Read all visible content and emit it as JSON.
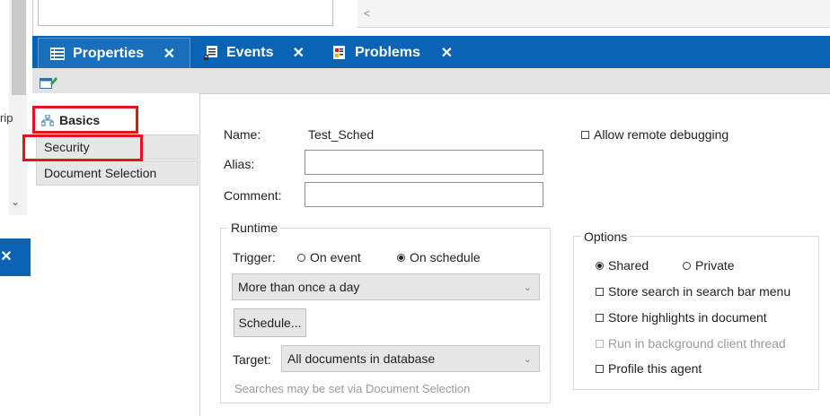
{
  "left_panel": {
    "clipped_text": "rip",
    "close_glyph": "✕"
  },
  "tabs": [
    {
      "label": "Properties",
      "icon": "properties-icon",
      "close": "✕",
      "active": true
    },
    {
      "label": "Events",
      "icon": "events-icon",
      "close": "✕",
      "active": false
    },
    {
      "label": "Problems",
      "icon": "problems-icon",
      "close": "✕",
      "active": false
    }
  ],
  "toolbar": {
    "icon": "edit-properties-icon"
  },
  "nav": {
    "items": [
      {
        "label": "Basics",
        "icon": "hierarchy-icon",
        "selected": true
      },
      {
        "label": "Security"
      },
      {
        "label": "Document Selection"
      }
    ]
  },
  "form": {
    "name_label": "Name:",
    "name_value": "Test_Sched",
    "alias_label": "Alias:",
    "alias_value": "",
    "comment_label": "Comment:",
    "comment_value": "",
    "allow_remote_debugging": {
      "label": "Allow remote debugging",
      "checked": false
    }
  },
  "runtime": {
    "title": "Runtime",
    "trigger_label": "Trigger:",
    "trigger_options": [
      {
        "label": "On event",
        "selected": false
      },
      {
        "label": "On schedule",
        "selected": true
      }
    ],
    "frequency_value": "More than once a day",
    "schedule_button": "Schedule...",
    "target_label": "Target:",
    "target_value": "All documents in database",
    "hint": "Searches may be set via Document Selection"
  },
  "options": {
    "title": "Options",
    "radios": [
      {
        "label": "Shared",
        "selected": true
      },
      {
        "label": "Private",
        "selected": false
      }
    ],
    "checks": [
      {
        "label": "Store search in search bar menu",
        "checked": false,
        "disabled": false
      },
      {
        "label": "Store highlights in document",
        "checked": false,
        "disabled": false
      },
      {
        "label": "Run in background client thread",
        "checked": false,
        "disabled": true
      },
      {
        "label": "Profile this agent",
        "checked": false,
        "disabled": false
      }
    ]
  },
  "colors": {
    "accent": "#0b63b3",
    "highlight": "#e3141b"
  }
}
